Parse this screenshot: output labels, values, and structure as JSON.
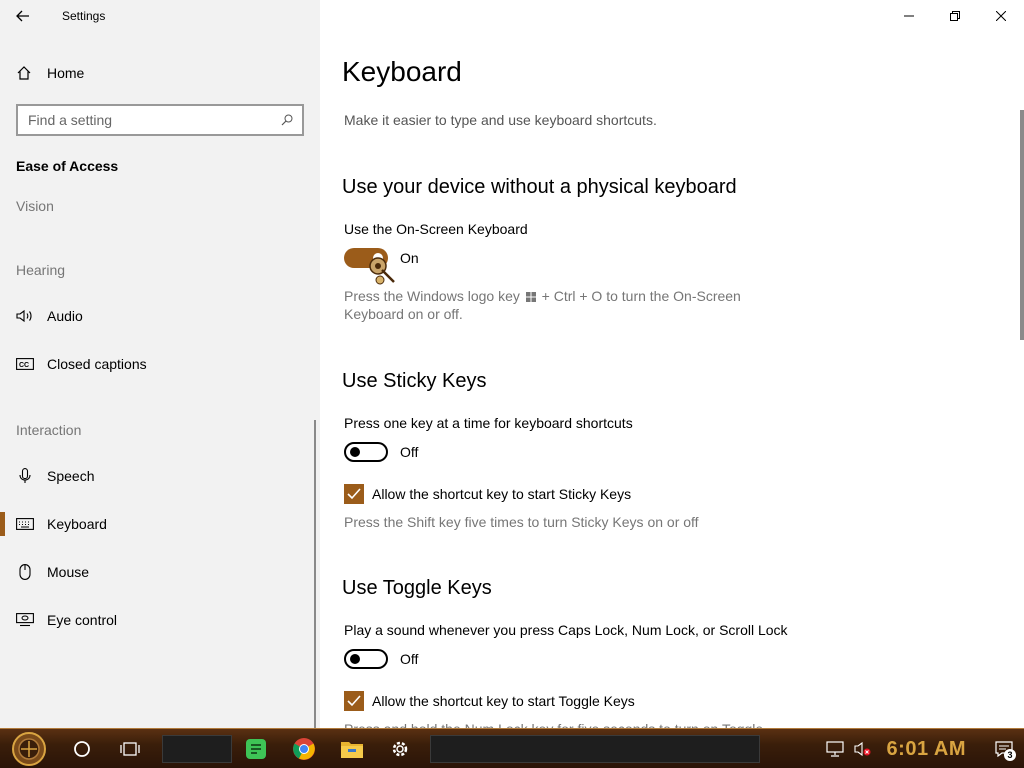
{
  "window": {
    "title": "Settings",
    "minimize_label": "Minimize",
    "maximize_label": "Restore",
    "close_label": "Close"
  },
  "sidebar": {
    "home_label": "Home",
    "search_placeholder": "Find a setting",
    "category": "Ease of Access",
    "groups": {
      "vision": "Vision",
      "hearing": "Hearing",
      "interaction": "Interaction"
    },
    "items": {
      "audio": "Audio",
      "closed_captions": "Closed captions",
      "speech": "Speech",
      "keyboard": "Keyboard",
      "mouse": "Mouse",
      "eye_control": "Eye control"
    },
    "selected": "Keyboard"
  },
  "main": {
    "title": "Keyboard",
    "description": "Make it easier to type and use keyboard shortcuts.",
    "onscreen": {
      "heading": "Use your device without a physical keyboard",
      "label": "Use the On-Screen Keyboard",
      "state": "On",
      "desc_part1": "Press the Windows logo key",
      "desc_part2": "+ Ctrl + O to turn the On-Screen",
      "desc_line2": "Keyboard on or off."
    },
    "sticky": {
      "heading": "Use Sticky Keys",
      "label": "Press one key at a time for keyboard shortcuts",
      "state": "Off",
      "checkbox_label": "Allow the shortcut key to start Sticky Keys",
      "checkbox_checked": true,
      "desc": "Press the Shift key five times to turn Sticky Keys on or off"
    },
    "toggle": {
      "heading": "Use Toggle Keys",
      "label": "Play a sound whenever you press Caps Lock, Num Lock, or Scroll Lock",
      "state": "Off",
      "checkbox_label": "Allow the shortcut key to start Toggle Keys",
      "checkbox_checked": true,
      "desc_partial": "Press and hold the Num Lock key for five seconds to turn on Toggle"
    }
  },
  "taskbar": {
    "clock": "6:01 AM",
    "notification_count": "3",
    "icons": [
      "start-icon",
      "cortana-icon",
      "task-view-icon",
      "notes-app-icon",
      "chrome-icon",
      "file-explorer-icon",
      "settings-icon"
    ],
    "tray_icons": [
      "network-icon",
      "volume-muted-icon",
      "notifications-icon"
    ]
  },
  "colors": {
    "accent": "#9b5c1a",
    "sidebar_bg": "#f2f2f2",
    "clock": "#d9a441"
  }
}
